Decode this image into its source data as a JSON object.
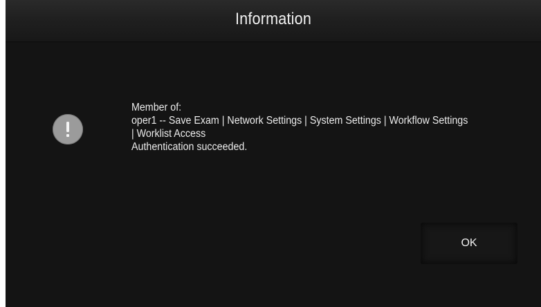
{
  "dialog": {
    "title": "Information",
    "icon": "exclamation-icon",
    "message_lines": [
      "Member of:",
      "oper1 -- Save Exam | Network Settings | System Settings | Workflow Settings",
      "| Worklist Access",
      "Authentication succeeded."
    ],
    "ok_label": "OK"
  },
  "colors": {
    "background": "#141414",
    "title_bar": "#1f1f1f",
    "text": "#ececec",
    "icon_fill": "#9b9b9b"
  }
}
